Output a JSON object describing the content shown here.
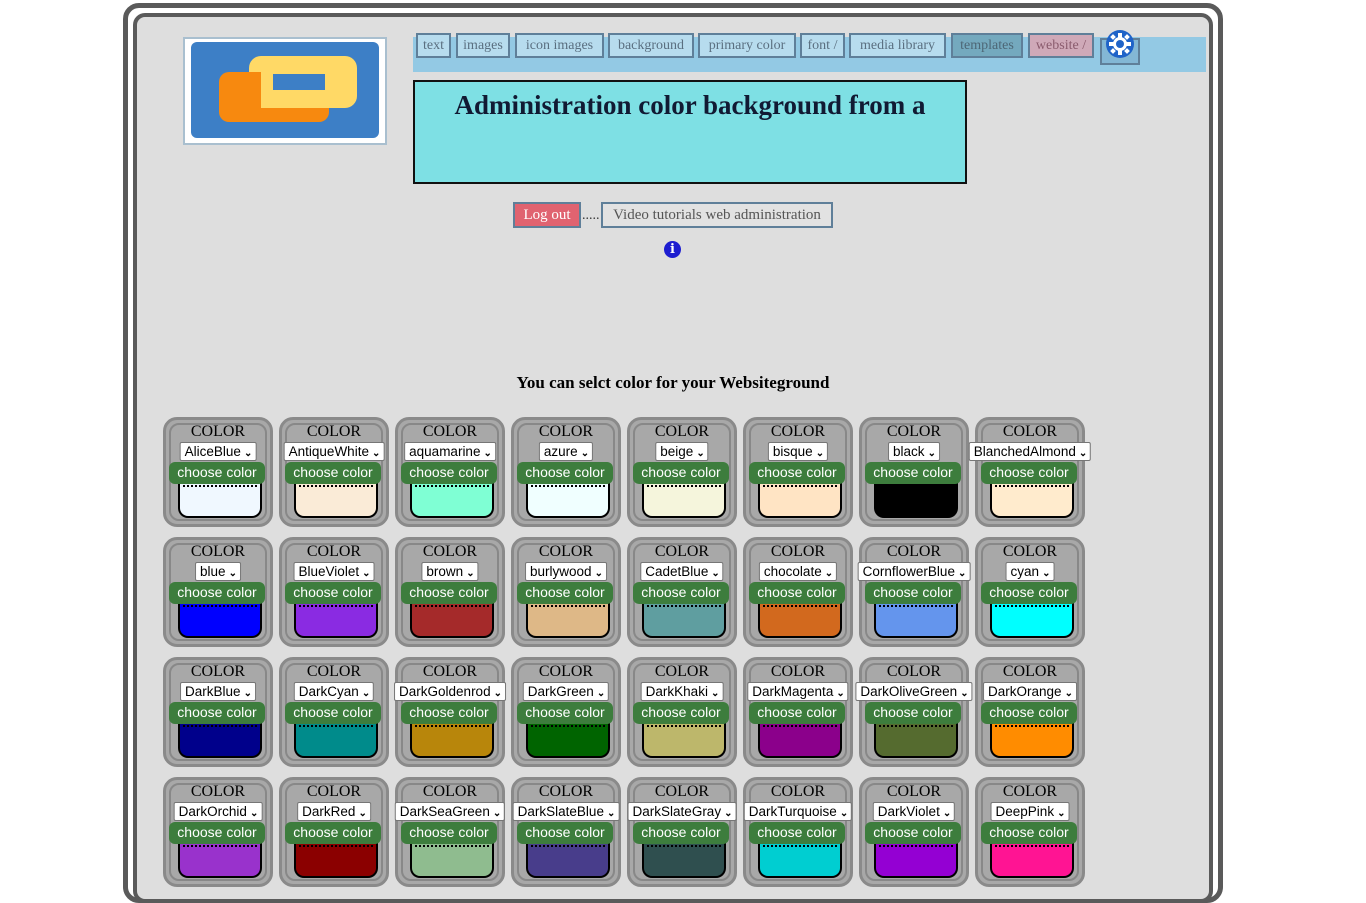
{
  "nav": {
    "items": [
      {
        "label": "text",
        "variant": "normal"
      },
      {
        "label": "images",
        "variant": "normal"
      },
      {
        "label": "icon images",
        "variant": "normal"
      },
      {
        "label": "background",
        "variant": "normal"
      },
      {
        "label": "primary color",
        "variant": "normal"
      },
      {
        "label": "font /",
        "variant": "normal"
      },
      {
        "label": "media library",
        "variant": "normal"
      },
      {
        "label": "templates",
        "variant": "tpl"
      },
      {
        "label": "website /",
        "variant": "web"
      }
    ],
    "gear_icon": "gear-icon"
  },
  "header": {
    "title": "Administration color background from a"
  },
  "actions": {
    "logout_label": "Log out",
    "dots": ".....",
    "video_label": "Video tutorials web administration",
    "info_icon": "info-icon"
  },
  "main": {
    "subtitle": "You can selct color for your Websiteground",
    "card_label": "COLOR",
    "button_label": "choose color",
    "colors": [
      {
        "name": "AliceBlue",
        "hex": "#f0f8ff"
      },
      {
        "name": "AntiqueWhite",
        "hex": "#faebd7"
      },
      {
        "name": "aquamarine",
        "hex": "#7fffd4"
      },
      {
        "name": "azure",
        "hex": "#f0ffff"
      },
      {
        "name": "beige",
        "hex": "#f5f5dc"
      },
      {
        "name": "bisque",
        "hex": "#ffe4c4"
      },
      {
        "name": "black",
        "hex": "#000000"
      },
      {
        "name": "BlanchedAlmond",
        "hex": "#ffebcd"
      },
      {
        "name": "blue",
        "hex": "#0000ff"
      },
      {
        "name": "BlueViolet",
        "hex": "#8a2be2"
      },
      {
        "name": "brown",
        "hex": "#a52a2a"
      },
      {
        "name": "burlywood",
        "hex": "#deb887"
      },
      {
        "name": "CadetBlue",
        "hex": "#5f9ea0"
      },
      {
        "name": "chocolate",
        "hex": "#d2691e"
      },
      {
        "name": "CornflowerBlue",
        "hex": "#6495ed"
      },
      {
        "name": "cyan",
        "hex": "#00ffff"
      },
      {
        "name": "DarkBlue",
        "hex": "#00008b"
      },
      {
        "name": "DarkCyan",
        "hex": "#008b8b"
      },
      {
        "name": "DarkGoldenrod",
        "hex": "#b8860b"
      },
      {
        "name": "DarkGreen",
        "hex": "#006400"
      },
      {
        "name": "DarkKhaki",
        "hex": "#bdb76b"
      },
      {
        "name": "DarkMagenta",
        "hex": "#8b008b"
      },
      {
        "name": "DarkOliveGreen",
        "hex": "#556b2f"
      },
      {
        "name": "DarkOrange",
        "hex": "#ff8c00"
      },
      {
        "name": "DarkOrchid",
        "hex": "#9932cc"
      },
      {
        "name": "DarkRed",
        "hex": "#8b0000"
      },
      {
        "name": "DarkSeaGreen",
        "hex": "#8fbc8f"
      },
      {
        "name": "DarkSlateBlue",
        "hex": "#483d8b"
      },
      {
        "name": "DarkSlateGray",
        "hex": "#2f4f4f"
      },
      {
        "name": "DarkTurquoise",
        "hex": "#00ced1"
      },
      {
        "name": "DarkViolet",
        "hex": "#9400d3"
      },
      {
        "name": "DeepPink",
        "hex": "#ff1493"
      }
    ]
  }
}
